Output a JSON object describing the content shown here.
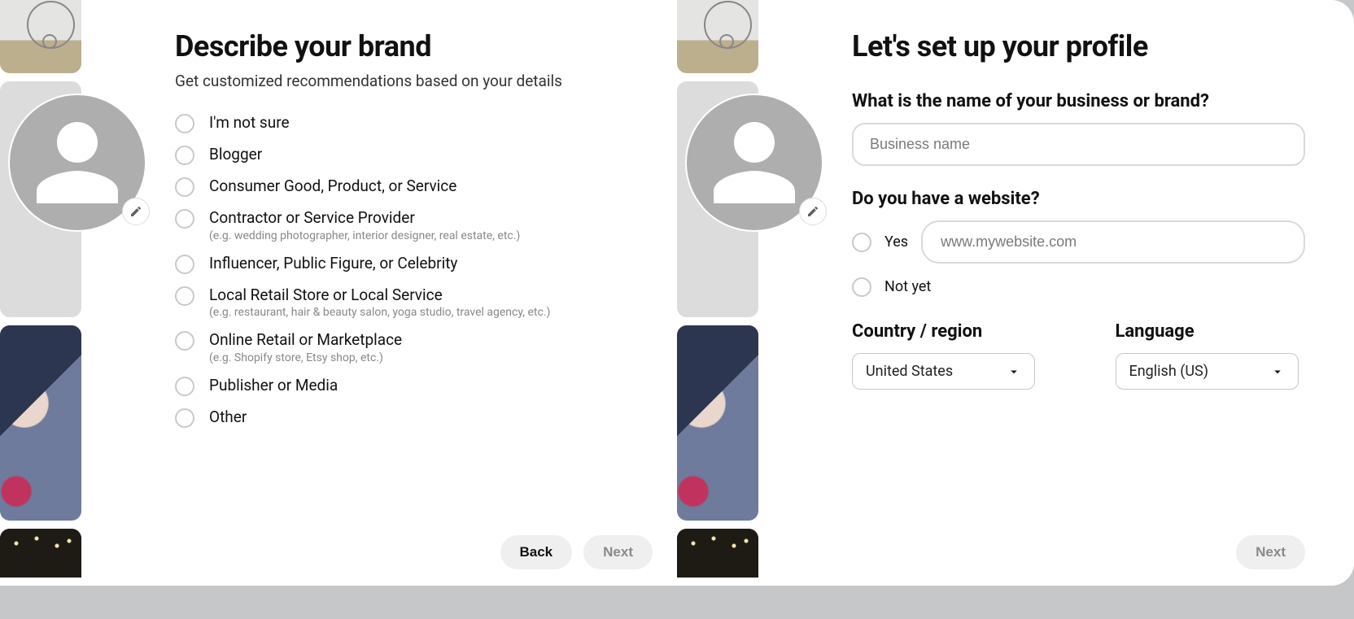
{
  "left": {
    "heading": "Describe your brand",
    "subheading": "Get customized recommendations based on your details",
    "options": [
      {
        "label": "I'm not sure",
        "sub": ""
      },
      {
        "label": "Blogger",
        "sub": ""
      },
      {
        "label": "Consumer Good, Product, or Service",
        "sub": ""
      },
      {
        "label": "Contractor or Service Provider",
        "sub": "(e.g. wedding photographer, interior designer, real estate, etc.)"
      },
      {
        "label": "Influencer, Public Figure, or Celebrity",
        "sub": ""
      },
      {
        "label": "Local Retail Store or Local Service",
        "sub": "(e.g. restaurant, hair & beauty salon, yoga studio, travel agency, etc.)"
      },
      {
        "label": "Online Retail or Marketplace",
        "sub": "(e.g. Shopify store, Etsy shop, etc.)"
      },
      {
        "label": "Publisher or Media",
        "sub": ""
      },
      {
        "label": "Other",
        "sub": ""
      }
    ],
    "back_label": "Back",
    "next_label": "Next"
  },
  "right": {
    "heading": "Let's set up your profile",
    "name_question": "What is the name of your business or brand?",
    "name_placeholder": "Business name",
    "website_question": "Do you have a website?",
    "yes_label": "Yes",
    "website_placeholder": "www.mywebsite.com",
    "notyet_label": "Not yet",
    "country_label": "Country / region",
    "country_value": "United States",
    "language_label": "Language",
    "language_value": "English (US)",
    "next_label": "Next"
  }
}
